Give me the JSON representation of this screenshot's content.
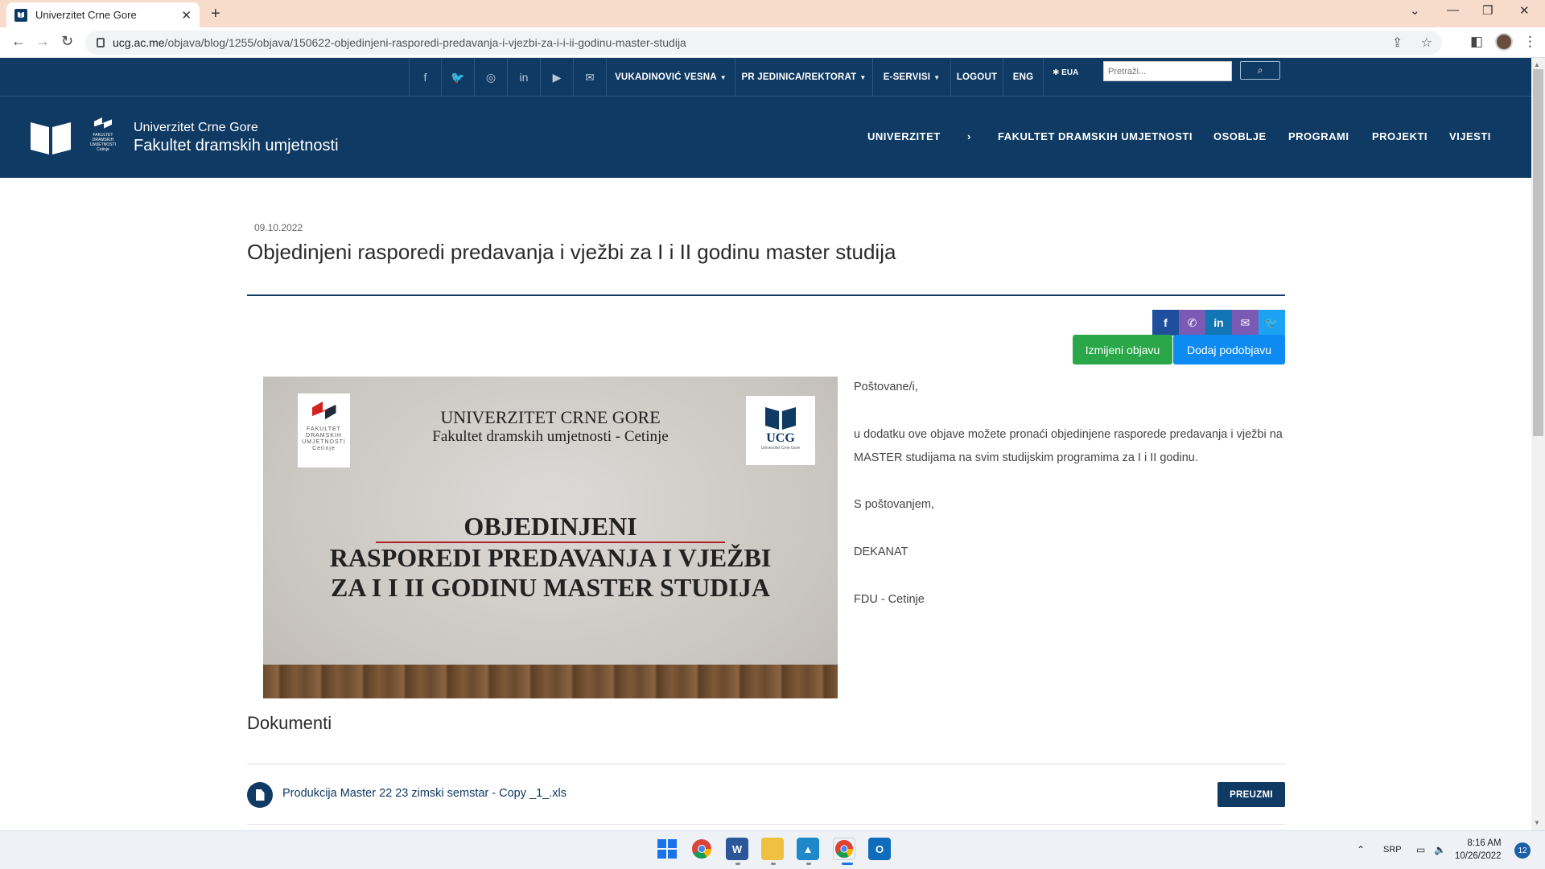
{
  "browser": {
    "tab_title": "Univerzitet Crne Gore",
    "url_host": "ucg.ac.me",
    "url_path": "/objava/blog/1255/objava/150622-objedinjeni-rasporedi-predavanja-i-vjezbi-za-i-i-ii-godinu-master-studija"
  },
  "topbar": {
    "social_icons": [
      "facebook-icon",
      "twitter-icon",
      "instagram-icon",
      "linkedin-icon",
      "youtube-icon",
      "mail-icon"
    ],
    "menus": [
      {
        "label": "VUKADINOVIĆ VESNA"
      },
      {
        "label": "PR JEDINICA/REKTORAT"
      },
      {
        "label": "E-SERVISI"
      },
      {
        "label": "LOGOUT"
      },
      {
        "label": "ENG"
      }
    ],
    "eua_label": "EUA",
    "search_placeholder": "Pretraži..."
  },
  "header": {
    "brand_line1": "Univerzitet Crne Gore",
    "brand_line2": "Fakultet dramskih umjetnosti",
    "fdu_logo_text": "FAKULTET DRAMSKIH UMJETNOSTI Cetinje",
    "nav": [
      {
        "label": "UNIVERZITET"
      },
      {
        "label": "›"
      },
      {
        "label": "FAKULTET DRAMSKIH UMJETNOSTI"
      },
      {
        "label": "OSOBLJE"
      },
      {
        "label": "PROGRAMI"
      },
      {
        "label": "PROJEKTI"
      },
      {
        "label": "VIJESTI"
      }
    ]
  },
  "post": {
    "date": "09.10.2022",
    "title": "Objedinjeni rasporedi predavanja i vježbi za I i II godinu master studija",
    "edit_label": "Izmijeni objavu",
    "add_label": "Dodaj podobjavu",
    "share": [
      {
        "icon": "facebook-icon",
        "color": "#1f4f9c"
      },
      {
        "icon": "phone-icon",
        "color": "#7a5ab5"
      },
      {
        "icon": "linkedin-icon",
        "color": "#1276b5"
      },
      {
        "icon": "mail-icon",
        "color": "#7a5ab5"
      },
      {
        "icon": "twitter-icon",
        "color": "#1da1f2"
      }
    ],
    "image": {
      "logo_left_text": "FAKULTET DRAMSKIH UMJETNOSTI Cetinje",
      "logo_right_abbr": "UCG",
      "logo_right_sub": "Univerzitet Crne Gore",
      "heading1": "UNIVERZITET CRNE GORE",
      "heading2": "Fakultet dramskih umjetnosti - Cetinje",
      "banner1": "OBJEDINJENI",
      "banner2": "RASPOREDI PREDAVANJA I VJEŽBI",
      "banner3": "ZA I I II GODINU MASTER STUDIJA"
    },
    "body": [
      "Poštovane/i,",
      "",
      "u dodatku ove objave možete pronaći objedinjene rasporede predavanja i vježbi na MASTER studijama na svim studijskim programima za I i II godinu.",
      "",
      "S poštovanjem,",
      "",
      "DEKANAT",
      "",
      "FDU - Cetinje"
    ]
  },
  "documents": {
    "title": "Dokumenti",
    "items": [
      {
        "name": "Produkcija Master 22 23 zimski semstar - Copy _1_.xls",
        "download_label": "PREUZMI"
      }
    ]
  },
  "taskbar": {
    "apps": [
      "windows-start-icon",
      "chrome-icon",
      "word-icon",
      "file-explorer-icon",
      "photos-icon",
      "chrome-profile-icon",
      "outlook-icon"
    ],
    "language": "SRP",
    "time": "8:16 AM",
    "date": "10/26/2022",
    "notification_count": "12"
  }
}
